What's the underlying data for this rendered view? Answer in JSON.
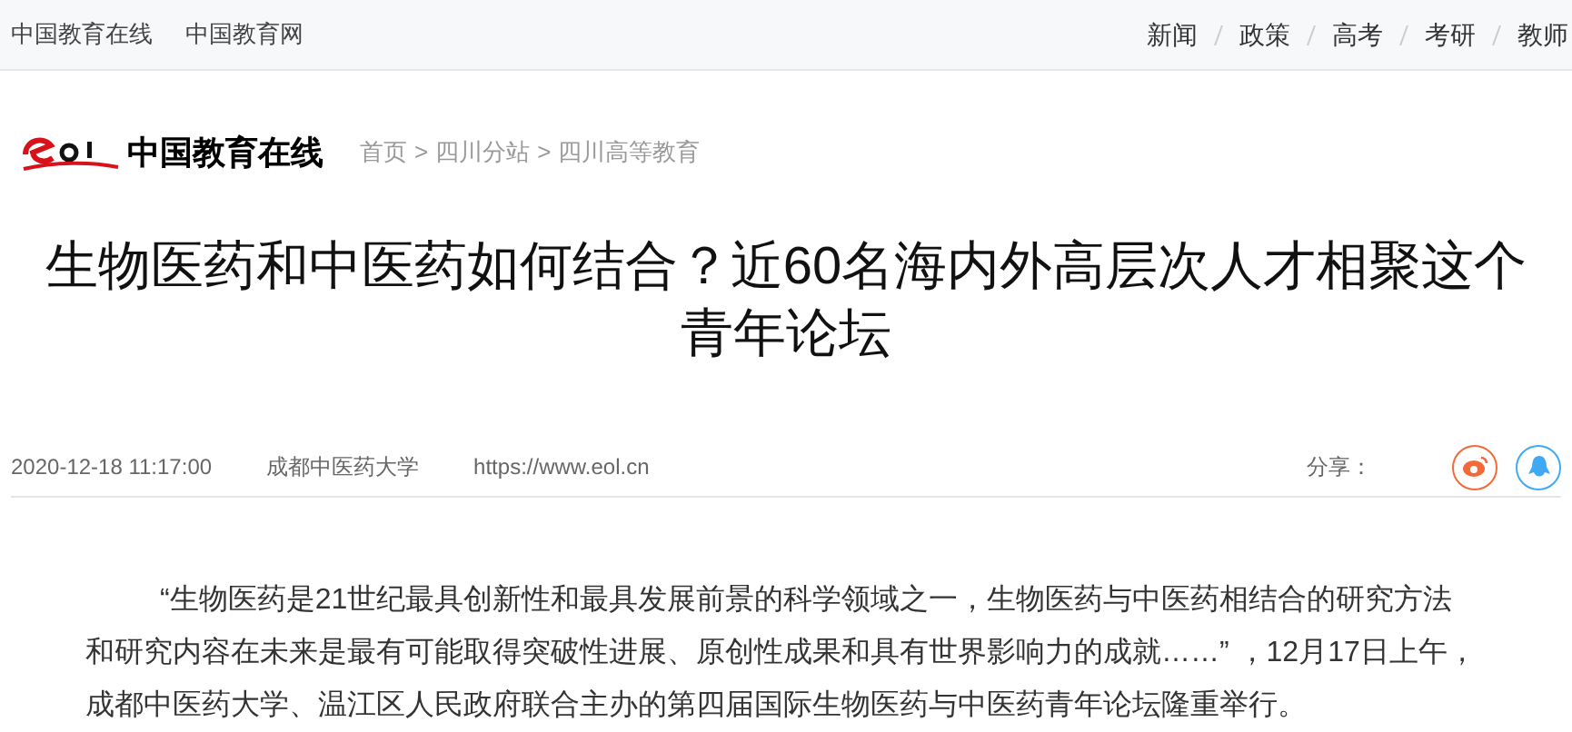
{
  "top_bar": {
    "site_links": [
      "中国教育在线",
      "中国教育网"
    ],
    "nav": [
      "新闻",
      "政策",
      "高考",
      "考研",
      "教师"
    ]
  },
  "header": {
    "logo_text": "中国教育在线",
    "breadcrumb": [
      "首页",
      "四川分站",
      "四川高等教育"
    ],
    "separator": ">"
  },
  "article": {
    "title": "生物医药和中医药如何结合？近60名海内外高层次人才相聚这个青年论坛",
    "meta": {
      "date": "2020-12-18 11:17:00",
      "source": "成都中医药大学",
      "url": "https://www.eol.cn",
      "share_label": "分享："
    },
    "paragraph": "“生物医药是21世纪最具创新性和最具发展前景的科学领域之一，生物医药与中医药相结合的研究方法和研究内容在未来是最有可能取得突破性进展、原创性成果和具有世界影响力的成就……” ，12月17日上午，成都中医药大学、温江区人民政府联合主办的第四届国际生物医药与中医药青年论坛隆重举行。"
  }
}
